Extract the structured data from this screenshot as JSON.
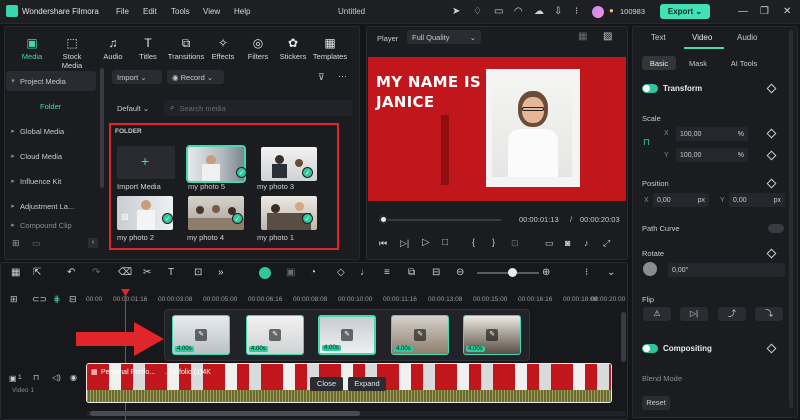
{
  "app": {
    "name": "Wondershare Filmora",
    "document_title": "Untitled",
    "credits": "100983",
    "export_label": "Export"
  },
  "menu": [
    "File",
    "Edit",
    "Tools",
    "View",
    "Help"
  ],
  "toolbar_tabs": [
    {
      "label": "Media",
      "icon": "media-icon"
    },
    {
      "label": "Stock Media",
      "icon": "stock-media-icon"
    },
    {
      "label": "Audio",
      "icon": "audio-icon"
    },
    {
      "label": "Titles",
      "icon": "titles-icon"
    },
    {
      "label": "Transitions",
      "icon": "transitions-icon"
    },
    {
      "label": "Effects",
      "icon": "effects-icon"
    },
    {
      "label": "Filters",
      "icon": "filters-icon"
    },
    {
      "label": "Stickers",
      "icon": "stickers-icon"
    },
    {
      "label": "Templates",
      "icon": "templates-icon"
    }
  ],
  "sidebar": {
    "project_media": "Project Media",
    "folder": "Folder",
    "items": [
      "Global Media",
      "Cloud Media",
      "Influence Kit",
      "Adjustment La...",
      "Compound Clip"
    ]
  },
  "media": {
    "import_label": "Import",
    "record_label": "Record",
    "sort_label": "Default",
    "search_placeholder": "Search media",
    "folder_heading": "FOLDER",
    "items": [
      "Import Media",
      "my photo 5",
      "my photo 3",
      "my photo 2",
      "my photo 4",
      "my photo 1"
    ]
  },
  "player": {
    "label": "Player",
    "quality": "Full Quality",
    "preview_line1": "MY NAME IS",
    "preview_line2": "JANICE",
    "current_time": "00:00:01:13",
    "separator": "/",
    "total_time": "00:00:20:03",
    "progress": 0.04
  },
  "properties": {
    "tabs": [
      "Text",
      "Video",
      "Audio"
    ],
    "active_tab": "Video",
    "subtabs": [
      "Basic",
      "Mask",
      "AI Tools"
    ],
    "transform_label": "Transform",
    "scale_label": "Scale",
    "scale_x": "100,00",
    "scale_y": "100,00",
    "percent": "%",
    "x_label": "X",
    "y_label": "Y",
    "position_label": "Position",
    "pos_x": "0,00",
    "pos_y": "0,00",
    "px": "px",
    "path_curve_label": "Path Curve",
    "rotate_label": "Rotate",
    "rotate_value": "0,00°",
    "flip_label": "Flip",
    "compositing_label": "Compositing",
    "blend_mode_label": "Blend Mode",
    "reset_label": "Reset"
  },
  "timeline": {
    "ruler": [
      "00:00",
      "00:00:01:16",
      "00:00:03:08",
      "00:00:05:00",
      "00:00:06:16",
      "00:00:08:08",
      "00:00:10:00",
      "00:00:11:16",
      "00:00:13:08",
      "00:00:15:00",
      "00:00:16:16",
      "00:00:18:08",
      "00:00:20:00"
    ],
    "clip_title": "Personal Portfo...",
    "clip_suffix": "...ortfolio (1)4K",
    "close_label": "Close",
    "expand_label": "Expand",
    "track_label": "Video 1",
    "track_number": "1",
    "popup_durations": [
      "4.00s",
      "4.00s",
      "4.00s",
      "4.00s",
      "4.00s"
    ]
  },
  "colors": {
    "accent": "#30c79a",
    "export_bg": "#42e0b6",
    "preview_red": "#c0161c",
    "highlight_border": "#e0262b"
  }
}
